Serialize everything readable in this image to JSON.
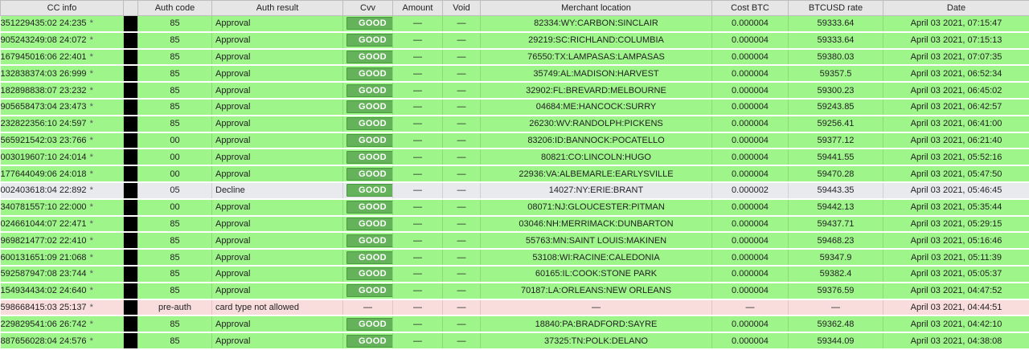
{
  "columns": [
    "CC info",
    "",
    "Auth code",
    "Auth result",
    "Cvv",
    "Amount",
    "Void",
    "Merchant location",
    "Cost BTC",
    "BTCUSD rate",
    "Date"
  ],
  "status_colors": {
    "approval": "#9ef58a",
    "decline": "#e9eaee",
    "preauth": "#f9dcdc",
    "good_badge": "#64b35a"
  },
  "rows": [
    {
      "cc": "351229435:02 24:235",
      "star": "*",
      "auth_code": "85",
      "auth_result": "Approval",
      "status": "approval",
      "cvv": "GOOD",
      "amount": "—",
      "void": "—",
      "merchant": "82334:WY:CARBON:SINCLAIR",
      "cost_btc": "0.000004",
      "rate": "59333.64",
      "date": "April 03 2021, 07:15:47"
    },
    {
      "cc": "905243249:08 24:072",
      "star": "*",
      "auth_code": "85",
      "auth_result": "Approval",
      "status": "approval",
      "cvv": "GOOD",
      "amount": "—",
      "void": "—",
      "merchant": "29219:SC:RICHLAND:COLUMBIA",
      "cost_btc": "0.000004",
      "rate": "59333.64",
      "date": "April 03 2021, 07:15:13"
    },
    {
      "cc": "167945016:06 22:401",
      "star": "*",
      "auth_code": "85",
      "auth_result": "Approval",
      "status": "approval",
      "cvv": "GOOD",
      "amount": "—",
      "void": "—",
      "merchant": "76550:TX:LAMPASAS:LAMPASAS",
      "cost_btc": "0.000004",
      "rate": "59380.03",
      "date": "April 03 2021, 07:07:35"
    },
    {
      "cc": "132838374:03 26:999",
      "star": "*",
      "auth_code": "85",
      "auth_result": "Approval",
      "status": "approval",
      "cvv": "GOOD",
      "amount": "—",
      "void": "—",
      "merchant": "35749:AL:MADISON:HARVEST",
      "cost_btc": "0.000004",
      "rate": "59357.5",
      "date": "April 03 2021, 06:52:34"
    },
    {
      "cc": "182898838:07 23:232",
      "star": "*",
      "auth_code": "85",
      "auth_result": "Approval",
      "status": "approval",
      "cvv": "GOOD",
      "amount": "—",
      "void": "—",
      "merchant": "32902:FL:BREVARD:MELBOURNE",
      "cost_btc": "0.000004",
      "rate": "59300.23",
      "date": "April 03 2021, 06:45:02"
    },
    {
      "cc": "905658473:04 23:473",
      "star": "*",
      "auth_code": "85",
      "auth_result": "Approval",
      "status": "approval",
      "cvv": "GOOD",
      "amount": "—",
      "void": "—",
      "merchant": "04684:ME:HANCOCK:SURRY",
      "cost_btc": "0.000004",
      "rate": "59243.85",
      "date": "April 03 2021, 06:42:57"
    },
    {
      "cc": "232822356:10 24:597",
      "star": "*",
      "auth_code": "85",
      "auth_result": "Approval",
      "status": "approval",
      "cvv": "GOOD",
      "amount": "—",
      "void": "—",
      "merchant": "26230:WV:RANDOLPH:PICKENS",
      "cost_btc": "0.000004",
      "rate": "59256.41",
      "date": "April 03 2021, 06:41:00"
    },
    {
      "cc": "565921542:03 23:766",
      "star": "*",
      "auth_code": "00",
      "auth_result": "Approval",
      "status": "approval",
      "cvv": "GOOD",
      "amount": "—",
      "void": "—",
      "merchant": "83206:ID:BANNOCK:POCATELLO",
      "cost_btc": "0.000004",
      "rate": "59377.12",
      "date": "April 03 2021, 06:21:40"
    },
    {
      "cc": "003019607:10 24:014",
      "star": "*",
      "auth_code": "00",
      "auth_result": "Approval",
      "status": "approval",
      "cvv": "GOOD",
      "amount": "—",
      "void": "—",
      "merchant": "80821:CO:LINCOLN:HUGO",
      "cost_btc": "0.000004",
      "rate": "59441.55",
      "date": "April 03 2021, 05:52:16"
    },
    {
      "cc": "177644049:06 24:018",
      "star": "*",
      "auth_code": "00",
      "auth_result": "Approval",
      "status": "approval",
      "cvv": "GOOD",
      "amount": "—",
      "void": "—",
      "merchant": "22936:VA:ALBEMARLE:EARLYSVILLE",
      "cost_btc": "0.000004",
      "rate": "59470.28",
      "date": "April 03 2021, 05:47:50"
    },
    {
      "cc": "002403618:04 22:892",
      "star": "*",
      "auth_code": "05",
      "auth_result": "Decline",
      "status": "decline",
      "cvv": "GOOD",
      "amount": "—",
      "void": "—",
      "merchant": "14027:NY:ERIE:BRANT",
      "cost_btc": "0.000002",
      "rate": "59443.35",
      "date": "April 03 2021, 05:46:45"
    },
    {
      "cc": "340781557:10 22:000",
      "star": "*",
      "auth_code": "00",
      "auth_result": "Approval",
      "status": "approval",
      "cvv": "GOOD",
      "amount": "—",
      "void": "—",
      "merchant": "08071:NJ:GLOUCESTER:PITMAN",
      "cost_btc": "0.000004",
      "rate": "59442.13",
      "date": "April 03 2021, 05:35:44"
    },
    {
      "cc": "024661044:07 22:471",
      "star": "*",
      "auth_code": "85",
      "auth_result": "Approval",
      "status": "approval",
      "cvv": "GOOD",
      "amount": "—",
      "void": "—",
      "merchant": "03046:NH:MERRIMACK:DUNBARTON",
      "cost_btc": "0.000004",
      "rate": "59437.71",
      "date": "April 03 2021, 05:29:15"
    },
    {
      "cc": "969821477:02 22:410",
      "star": "*",
      "auth_code": "85",
      "auth_result": "Approval",
      "status": "approval",
      "cvv": "GOOD",
      "amount": "—",
      "void": "—",
      "merchant": "55763:MN:SAINT LOUIS:MAKINEN",
      "cost_btc": "0.000004",
      "rate": "59468.23",
      "date": "April 03 2021, 05:16:46"
    },
    {
      "cc": "600131651:09 21:068",
      "star": "*",
      "auth_code": "85",
      "auth_result": "Approval",
      "status": "approval",
      "cvv": "GOOD",
      "amount": "—",
      "void": "—",
      "merchant": "53108:WI:RACINE:CALEDONIA",
      "cost_btc": "0.000004",
      "rate": "59347.9",
      "date": "April 03 2021, 05:11:39"
    },
    {
      "cc": "592587947:08 23:744",
      "star": "*",
      "auth_code": "85",
      "auth_result": "Approval",
      "status": "approval",
      "cvv": "GOOD",
      "amount": "—",
      "void": "—",
      "merchant": "60165:IL:COOK:STONE PARK",
      "cost_btc": "0.000004",
      "rate": "59382.4",
      "date": "April 03 2021, 05:05:37"
    },
    {
      "cc": "154934434:02 24:640",
      "star": "*",
      "auth_code": "85",
      "auth_result": "Approval",
      "status": "approval",
      "cvv": "GOOD",
      "amount": "—",
      "void": "—",
      "merchant": "70187:LA:ORLEANS:NEW ORLEANS",
      "cost_btc": "0.000004",
      "rate": "59376.59",
      "date": "April 03 2021, 04:47:52"
    },
    {
      "cc": "598668415:03 25:137",
      "star": "*",
      "auth_code": "pre-auth",
      "auth_result": "card type not allowed",
      "status": "preauth",
      "cvv": "—",
      "amount": "—",
      "void": "—",
      "merchant": "—",
      "cost_btc": "—",
      "rate": "—",
      "date": "April 03 2021, 04:44:51"
    },
    {
      "cc": "229829541:06 26:742",
      "star": "*",
      "auth_code": "85",
      "auth_result": "Approval",
      "status": "approval",
      "cvv": "GOOD",
      "amount": "—",
      "void": "—",
      "merchant": "18840:PA:BRADFORD:SAYRE",
      "cost_btc": "0.000004",
      "rate": "59362.48",
      "date": "April 03 2021, 04:42:10"
    },
    {
      "cc": "887656028:04 24:576",
      "star": "*",
      "auth_code": "85",
      "auth_result": "Approval",
      "status": "approval",
      "cvv": "GOOD",
      "amount": "—",
      "void": "—",
      "merchant": "37325:TN:POLK:DELANO",
      "cost_btc": "0.000004",
      "rate": "59344.09",
      "date": "April 03 2021, 04:38:08"
    }
  ]
}
